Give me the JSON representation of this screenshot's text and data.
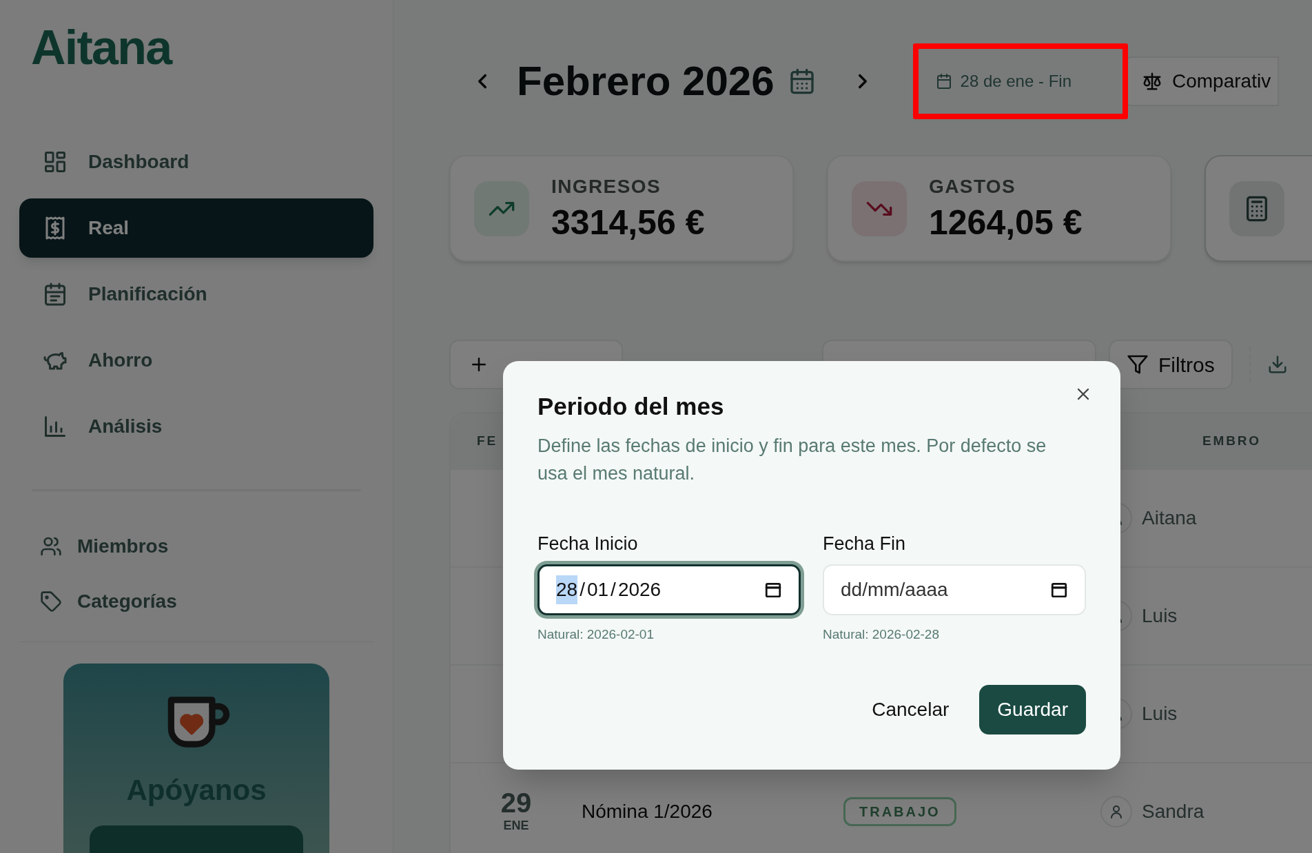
{
  "sidebar": {
    "logo": "Aitana",
    "nav": [
      {
        "label": "Dashboard",
        "selected": false
      },
      {
        "label": "Real",
        "selected": true
      },
      {
        "label": "Planificación",
        "selected": false
      },
      {
        "label": "Ahorro",
        "selected": false
      },
      {
        "label": "Análisis",
        "selected": false
      }
    ],
    "secondary": [
      {
        "label": "Miembros"
      },
      {
        "label": "Categorías"
      }
    ],
    "support_card": {
      "title": "Apóyanos"
    }
  },
  "header": {
    "title": "Febrero 2026",
    "period": "28 de ene - Fin",
    "period_highlighted": true,
    "compare_button": "Comparativ"
  },
  "summary_cards": [
    {
      "kind": "income",
      "label": "INGRESOS",
      "value": "3314,56 €"
    },
    {
      "kind": "expense",
      "label": "GASTOS",
      "value": "1264,05 €"
    },
    {
      "kind": "balance"
    }
  ],
  "toolbar": {
    "filters_button": "Filtros"
  },
  "table": {
    "columns": [
      "FE",
      "EMBRO"
    ],
    "rows": [
      {
        "member": "Aitana"
      },
      {
        "member": "Luis"
      },
      {
        "member": "Luis"
      },
      {
        "day": "29",
        "month": "ENE",
        "concept": "Nómina 1/2026",
        "category": "TRABAJO",
        "member": "Sandra"
      }
    ]
  },
  "dialog": {
    "title": "Periodo del mes",
    "description": "Define las fechas de inicio y fin para este mes. Por defecto se usa el mes natural.",
    "fields": [
      {
        "label": "Fecha Inicio",
        "separator": "/",
        "segments": [
          {
            "text": "28",
            "selected": true
          },
          {
            "text": "01",
            "selected": false
          },
          {
            "text": "2026",
            "selected": false
          }
        ],
        "focused": true,
        "hint": "Natural: 2026-02-01"
      },
      {
        "label": "Fecha Fin",
        "placeholder": "dd/mm/aaaa",
        "focused": false,
        "hint": "Natural: 2026-02-28"
      }
    ],
    "buttons": [
      {
        "label": "Cancelar",
        "kind": "secondary"
      },
      {
        "label": "Guardar",
        "kind": "primary"
      }
    ]
  }
}
